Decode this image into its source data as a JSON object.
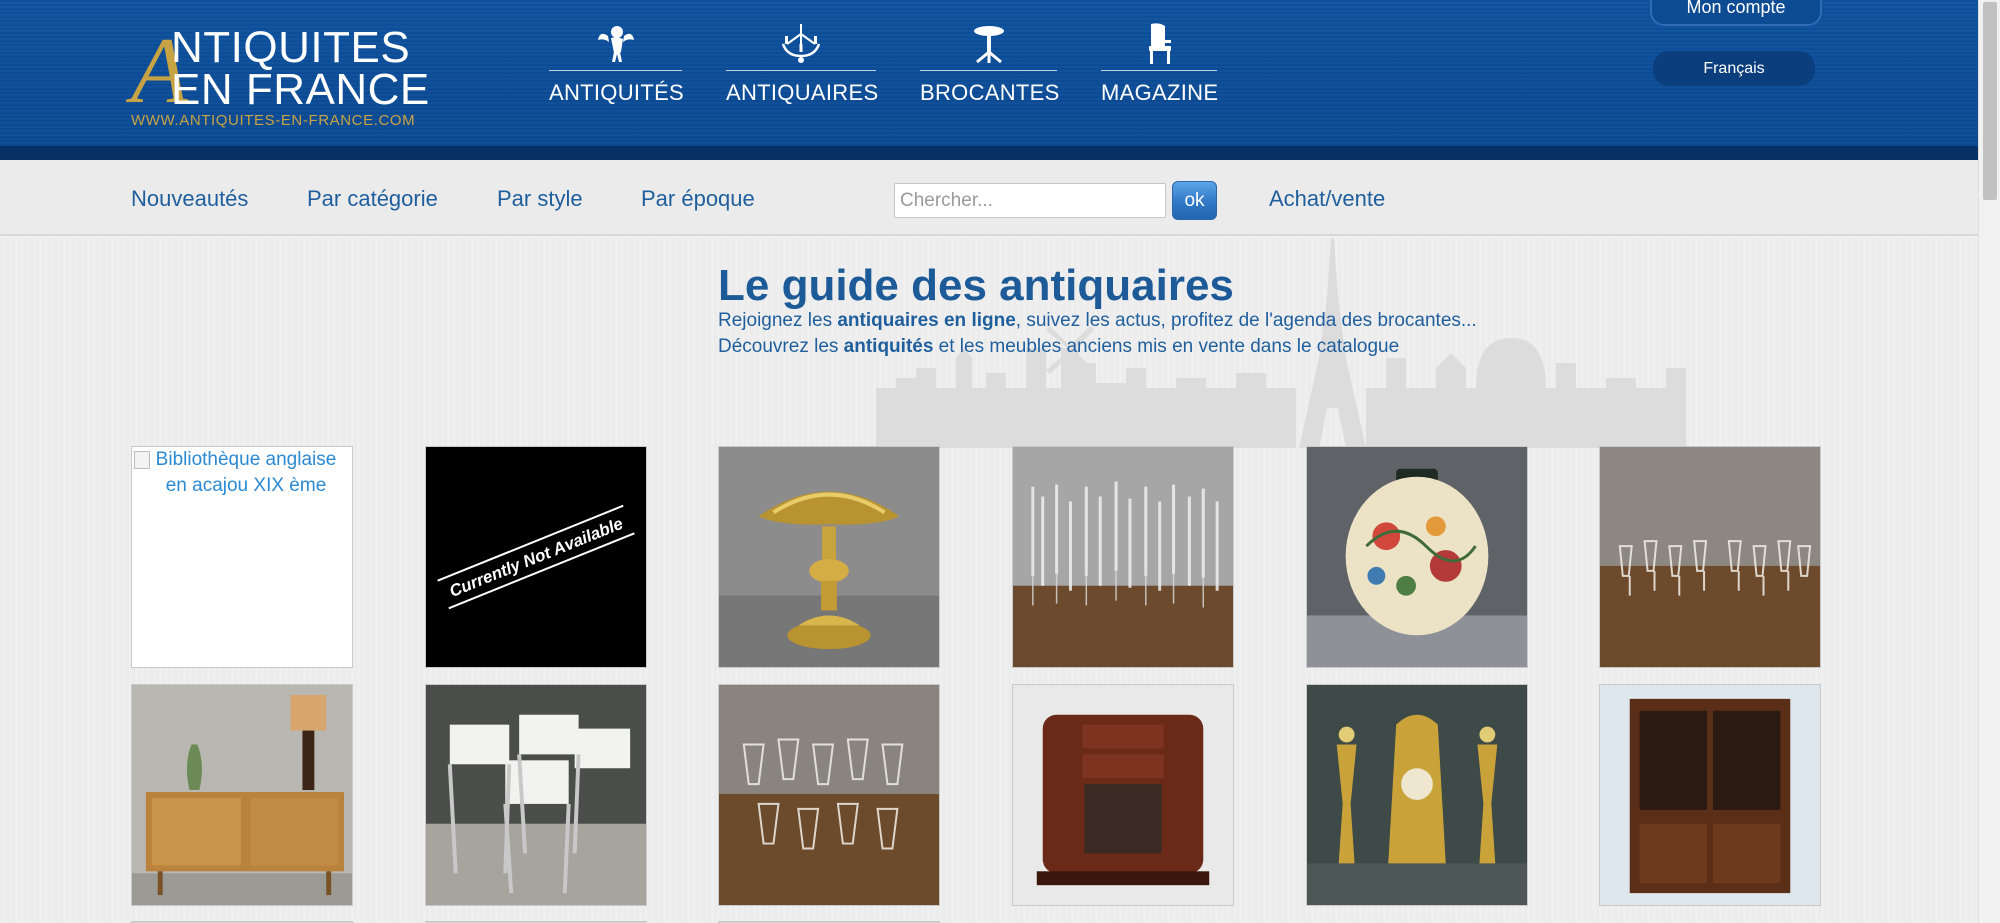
{
  "logo": {
    "big_letter": "A",
    "line1": "NTIQUITES",
    "line2": "EN FRANCE",
    "url": "WWW.ANTIQUITES-EN-FRANCE.COM"
  },
  "main_nav": [
    {
      "label": "ANTIQUITÉS",
      "icon": "cherub-icon"
    },
    {
      "label": "ANTIQUAIRES",
      "icon": "chandelier-icon"
    },
    {
      "label": "BROCANTES",
      "icon": "pedestal-table-icon"
    },
    {
      "label": "MAGAZINE",
      "icon": "chair-icon"
    }
  ],
  "account": {
    "label": "Mon compte"
  },
  "language": {
    "label": "Français"
  },
  "sub_nav": {
    "nouveautes": "Nouveautés",
    "categorie": "Par catégorie",
    "style": "Par style",
    "epoque": "Par époque",
    "achat_vente": "Achat/vente"
  },
  "search": {
    "placeholder": "Chercher...",
    "value": "",
    "button": "ok"
  },
  "guide": {
    "title": "Le guide des antiquaires",
    "line1_pre": "Rejoignez les ",
    "line1_bold": "antiquaires en ligne",
    "line1_post": ", suivez les actus, profitez de l'agenda des brocantes...",
    "line2_pre": "Découvrez les ",
    "line2_bold": "antiquités",
    "line2_post": " et les meubles anciens mis en vente dans le catalogue"
  },
  "products": [
    {
      "alt": "Bibliothèque anglaise en acajou XIX ème",
      "image": "broken-image"
    },
    {
      "image": "not-available",
      "banner": "Currently Not Available"
    },
    {
      "image": "brass-lamp"
    },
    {
      "image": "champagne-flutes"
    },
    {
      "image": "floral-vase"
    },
    {
      "image": "crystal-glasses"
    },
    {
      "image": "sideboard-lamp"
    },
    {
      "image": "white-chairs"
    },
    {
      "image": "crystal-glasses-2"
    },
    {
      "image": "art-deco-cabinet"
    },
    {
      "image": "bronze-clock-set"
    },
    {
      "image": "bookcase-cabinet"
    }
  ],
  "colors": {
    "header_blue": "#0d4d98",
    "gold": "#c8a343",
    "link_blue": "#1f5f9d"
  }
}
